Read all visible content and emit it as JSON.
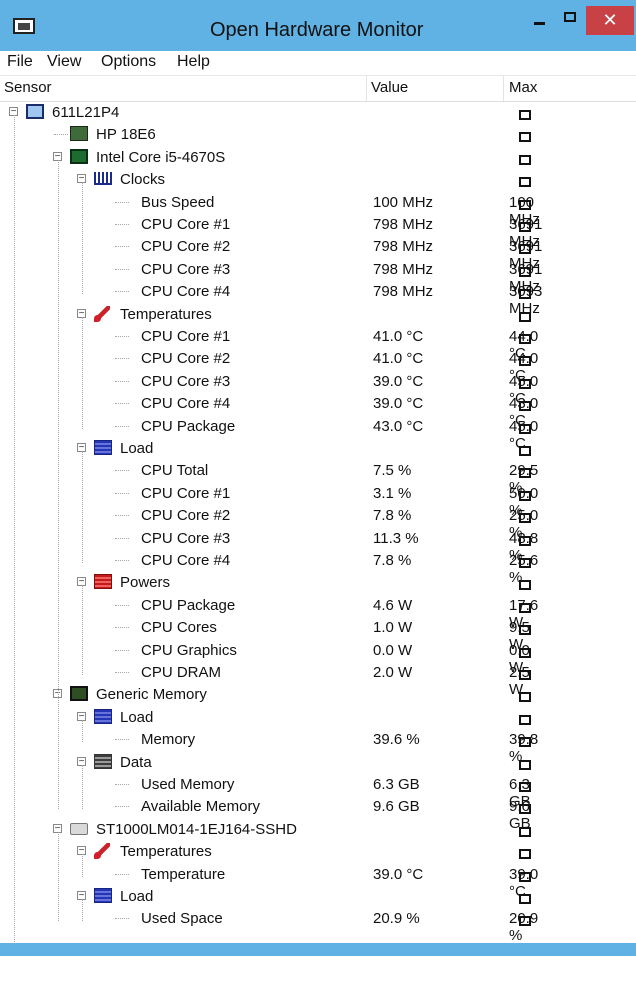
{
  "window": {
    "title": "Open Hardware Monitor",
    "close_symbol": "✕"
  },
  "menu": [
    "File",
    "View",
    "Options",
    "Help"
  ],
  "columns": {
    "sensor": "Sensor",
    "value": "Value",
    "max": "Max"
  },
  "tree": [
    {
      "level": 0,
      "icon": "computer-icon",
      "label": "611L21P4",
      "expander": "−",
      "value": "",
      "max": ""
    },
    {
      "level": 1,
      "icon": "motherboard-icon",
      "label": "HP 18E6",
      "expander": "",
      "value": "",
      "max": ""
    },
    {
      "level": 1,
      "icon": "cpu-icon",
      "label": "Intel Core i5-4670S",
      "expander": "−",
      "value": "",
      "max": ""
    },
    {
      "level": 2,
      "icon": "clock-icon",
      "label": "Clocks",
      "expander": "−",
      "value": "",
      "max": ""
    },
    {
      "level": 3,
      "icon": "",
      "label": "Bus Speed",
      "expander": "",
      "value": "100 MHz",
      "max": "100 MHz"
    },
    {
      "level": 3,
      "icon": "",
      "label": "CPU Core #1",
      "expander": "",
      "value": "798 MHz",
      "max": "3691 MHz"
    },
    {
      "level": 3,
      "icon": "",
      "label": "CPU Core #2",
      "expander": "",
      "value": "798 MHz",
      "max": "3691 MHz"
    },
    {
      "level": 3,
      "icon": "",
      "label": "CPU Core #3",
      "expander": "",
      "value": "798 MHz",
      "max": "3691 MHz"
    },
    {
      "level": 3,
      "icon": "",
      "label": "CPU Core #4",
      "expander": "",
      "value": "798 MHz",
      "max": "3093 MHz"
    },
    {
      "level": 2,
      "icon": "thermometer-icon",
      "label": "Temperatures",
      "expander": "−",
      "value": "",
      "max": ""
    },
    {
      "level": 3,
      "icon": "",
      "label": "CPU Core #1",
      "expander": "",
      "value": "41.0 °C",
      "max": "44.0 °C"
    },
    {
      "level": 3,
      "icon": "",
      "label": "CPU Core #2",
      "expander": "",
      "value": "41.0 °C",
      "max": "44.0 °C"
    },
    {
      "level": 3,
      "icon": "",
      "label": "CPU Core #3",
      "expander": "",
      "value": "39.0 °C",
      "max": "45.0 °C"
    },
    {
      "level": 3,
      "icon": "",
      "label": "CPU Core #4",
      "expander": "",
      "value": "39.0 °C",
      "max": "43.0 °C"
    },
    {
      "level": 3,
      "icon": "",
      "label": "CPU Package",
      "expander": "",
      "value": "43.0 °C",
      "max": "45.0 °C"
    },
    {
      "level": 2,
      "icon": "load-icon",
      "label": "Load",
      "expander": "−",
      "value": "",
      "max": ""
    },
    {
      "level": 3,
      "icon": "",
      "label": "CPU Total",
      "expander": "",
      "value": "7.5 %",
      "max": "29.5 %"
    },
    {
      "level": 3,
      "icon": "",
      "label": "CPU Core #1",
      "expander": "",
      "value": "3.1 %",
      "max": "50.0 %"
    },
    {
      "level": 3,
      "icon": "",
      "label": "CPU Core #2",
      "expander": "",
      "value": "7.8 %",
      "max": "25.0 %"
    },
    {
      "level": 3,
      "icon": "",
      "label": "CPU Core #3",
      "expander": "",
      "value": "11.3 %",
      "max": "48.8 %"
    },
    {
      "level": 3,
      "icon": "",
      "label": "CPU Core #4",
      "expander": "",
      "value": "7.8 %",
      "max": "25.6 %"
    },
    {
      "level": 2,
      "icon": "power-icon",
      "label": "Powers",
      "expander": "−",
      "value": "",
      "max": ""
    },
    {
      "level": 3,
      "icon": "",
      "label": "CPU Package",
      "expander": "",
      "value": "4.6 W",
      "max": "17.6 W"
    },
    {
      "level": 3,
      "icon": "",
      "label": "CPU Cores",
      "expander": "",
      "value": "1.0 W",
      "max": "9.5 W"
    },
    {
      "level": 3,
      "icon": "",
      "label": "CPU Graphics",
      "expander": "",
      "value": "0.0 W",
      "max": "0.0 W"
    },
    {
      "level": 3,
      "icon": "",
      "label": "CPU DRAM",
      "expander": "",
      "value": "2.0 W",
      "max": "2.5 W"
    },
    {
      "level": 1,
      "icon": "memory-icon",
      "label": "Generic Memory",
      "expander": "−",
      "value": "",
      "max": ""
    },
    {
      "level": 2,
      "icon": "load-icon",
      "label": "Load",
      "expander": "−",
      "value": "",
      "max": ""
    },
    {
      "level": 3,
      "icon": "",
      "label": "Memory",
      "expander": "",
      "value": "39.6 %",
      "max": "39.8 %"
    },
    {
      "level": 2,
      "icon": "data-icon",
      "label": "Data",
      "expander": "−",
      "value": "",
      "max": ""
    },
    {
      "level": 3,
      "icon": "",
      "label": "Used Memory",
      "expander": "",
      "value": "6.3 GB",
      "max": "6.3 GB"
    },
    {
      "level": 3,
      "icon": "",
      "label": "Available Memory",
      "expander": "",
      "value": "9.6 GB",
      "max": "9.6 GB"
    },
    {
      "level": 1,
      "icon": "hard-drive-icon",
      "label": "ST1000LM014-1EJ164-SSHD",
      "expander": "−",
      "value": "",
      "max": ""
    },
    {
      "level": 2,
      "icon": "thermometer-icon",
      "label": "Temperatures",
      "expander": "−",
      "value": "",
      "max": ""
    },
    {
      "level": 3,
      "icon": "",
      "label": "Temperature",
      "expander": "",
      "value": "39.0 °C",
      "max": "39.0 °C"
    },
    {
      "level": 2,
      "icon": "load-icon",
      "label": "Load",
      "expander": "−",
      "value": "",
      "max": ""
    },
    {
      "level": 3,
      "icon": "",
      "label": "Used Space",
      "expander": "",
      "value": "20.9 %",
      "max": "20.9 %"
    }
  ]
}
